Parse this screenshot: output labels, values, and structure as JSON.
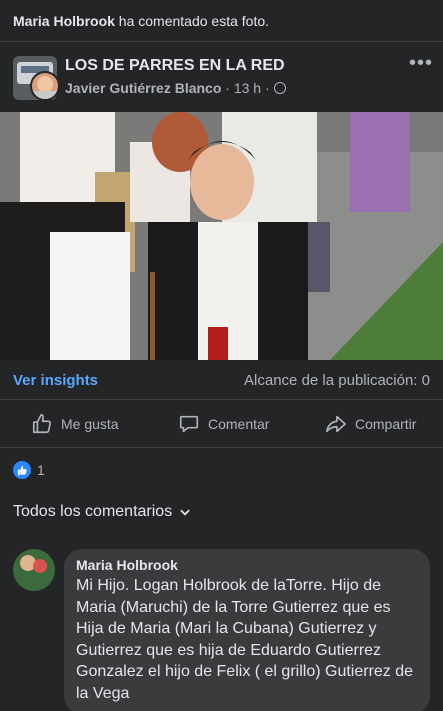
{
  "activity": {
    "name": "Maria Holbrook",
    "text": " ha comentado esta foto."
  },
  "post": {
    "group_name": "LOS DE PARRES EN LA RED",
    "author": "Javier Gutiérrez Blanco",
    "time": " · 13 h · "
  },
  "insights": {
    "link": "Ver insights",
    "reach": "Alcance de la publicación: 0"
  },
  "actions": {
    "like": "Me gusta",
    "comment": "Comentar",
    "share": "Compartir"
  },
  "reactions": {
    "count": "1"
  },
  "comments_filter": "Todos los comentarios",
  "comment": {
    "author": "Maria Holbrook",
    "text": "Mi Hijo. Logan Holbrook de laTorre. Hijo de Maria (Maruchi) de la Torre Gutierrez que es Hija de Maria (Mari la Cubana) Gutierrez y Gutierrez que es hija de Eduardo Gutierrez Gonzalez el hijo de Felix ( el grillo) Gutierrez de la   Vega"
  },
  "colors": {
    "background": "#242526",
    "link": "#5aa7ff",
    "like_blue": "#2d88ff",
    "bubble": "#3a3b3c"
  },
  "icons": [
    "ellipsis-icon",
    "globe-icon",
    "thumbs-up-icon",
    "comment-icon",
    "share-icon",
    "chevron-down-icon"
  ]
}
